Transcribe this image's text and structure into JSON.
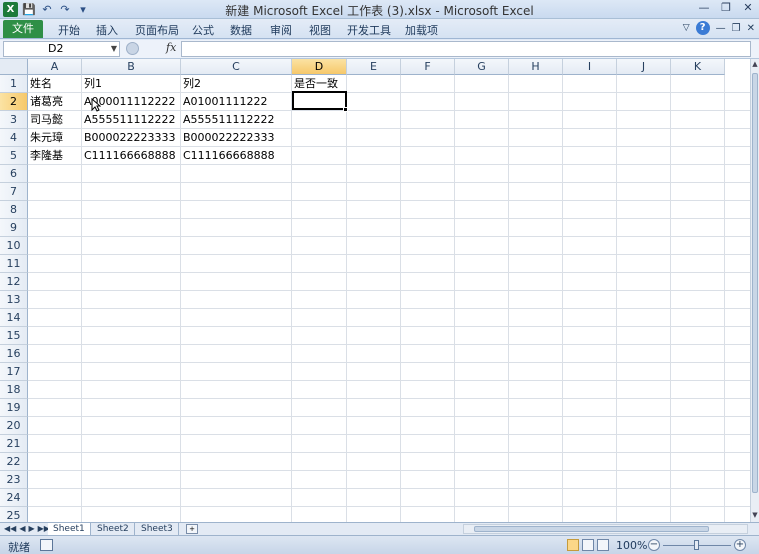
{
  "window": {
    "title": "新建 Microsoft Excel 工作表 (3).xlsx - Microsoft Excel",
    "app_icon": "X"
  },
  "quick_access": [
    "save-icon",
    "undo-icon",
    "redo-icon",
    "dropdown-icon"
  ],
  "ribbon": {
    "file_tab": "文件",
    "tabs": [
      "开始",
      "插入",
      "页面布局",
      "公式",
      "数据",
      "审阅",
      "视图",
      "开发工具",
      "加载项"
    ]
  },
  "formula_bar": {
    "name_box": "D2",
    "fx_label": "fx",
    "formula": ""
  },
  "sheet": {
    "columns": [
      "A",
      "B",
      "C",
      "D",
      "E",
      "F",
      "G",
      "H",
      "I",
      "J",
      "K"
    ],
    "selected_column": "D",
    "selected_row": 2,
    "rows": [
      "1",
      "2",
      "3",
      "4",
      "5",
      "6",
      "7",
      "8",
      "9",
      "10",
      "11",
      "12",
      "13",
      "14",
      "15",
      "16",
      "17",
      "18",
      "19",
      "20",
      "21",
      "22",
      "23",
      "24",
      "25"
    ],
    "header_row": [
      "姓名",
      "列1",
      "列2",
      "是否一致"
    ],
    "data_rows": [
      [
        "诸葛亮",
        "A000011112222",
        "A01001111222"
      ],
      [
        "司马懿",
        "A555511112222",
        "A555511112222"
      ],
      [
        "朱元璋",
        "B000022223333",
        "B000022222333"
      ],
      [
        "李隆基",
        "C111166668888",
        "C111166668888"
      ]
    ]
  },
  "sheet_tabs": [
    "Sheet1",
    "Sheet2",
    "Sheet3"
  ],
  "status": {
    "ready": "就绪",
    "zoom": "100%"
  },
  "colors": {
    "file_tab": "#2f8f46",
    "selected_header": "#f6c86a"
  }
}
